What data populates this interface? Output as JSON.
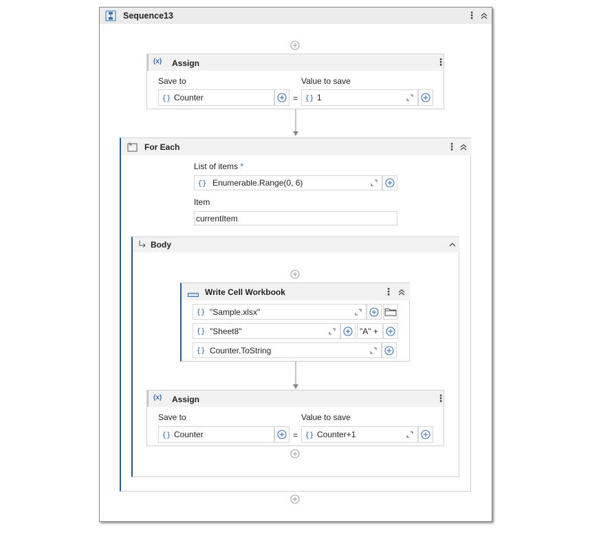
{
  "sequence": {
    "title": "Sequence13"
  },
  "assign1": {
    "title": "Assign",
    "save_to_label": "Save to",
    "value_label": "Value to save",
    "save_to_value": "Counter",
    "value": "1",
    "equals": "="
  },
  "foreach": {
    "title": "For Each",
    "list_label": "List of items",
    "required_mark": "*",
    "list_value": "Enumerable.Range(0, 6)",
    "item_label": "Item",
    "item_value": "currentItem"
  },
  "body": {
    "title": "Body"
  },
  "write_cell": {
    "title": "Write Cell Workbook",
    "workbook": "\"Sample.xlsx\"",
    "sheet": "\"Sheet8\"",
    "cell": "\"A\" +",
    "text": "Counter.ToString"
  },
  "assign2": {
    "title": "Assign",
    "save_to_label": "Save to",
    "value_label": "Value to save",
    "save_to_value": "Counter",
    "value": "Counter+1",
    "equals": "="
  },
  "icons": {
    "brace": "{}",
    "kebab": "⋮",
    "assign_icon": "(x)"
  },
  "colors": {
    "accent": "#2f6fbf",
    "header_bg": "#ececec",
    "body_border": "#1f5aa6"
  }
}
